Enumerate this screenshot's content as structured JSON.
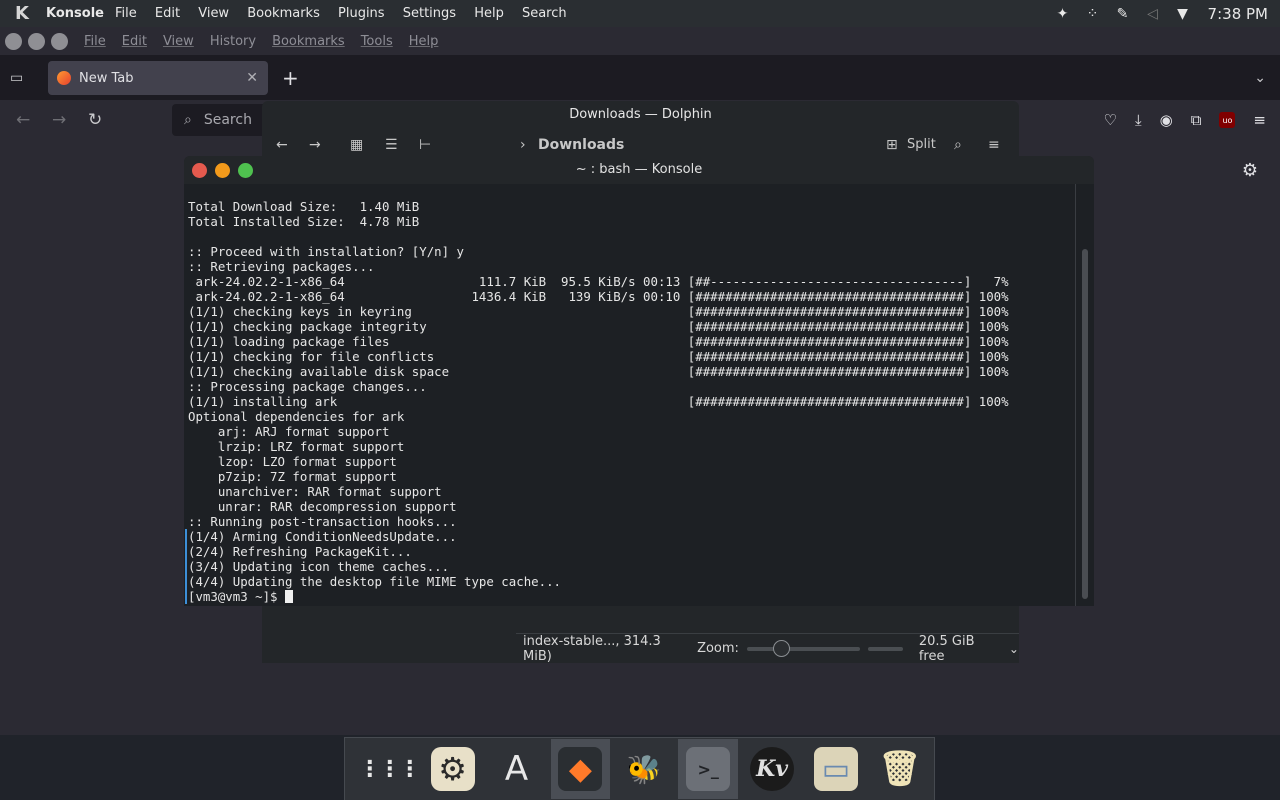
{
  "topbar": {
    "app_name": "Konsole",
    "menu": [
      "File",
      "Edit",
      "View",
      "Bookmarks",
      "Plugins",
      "Settings",
      "Help",
      "Search"
    ],
    "clock": "7:38 PM",
    "tray_icons": [
      "bee-icon",
      "network-icon",
      "pen-icon",
      "volume-icon",
      "chevron-down-icon"
    ]
  },
  "browser": {
    "menu": [
      "File",
      "Edit",
      "View",
      "History",
      "Bookmarks",
      "Tools",
      "Help"
    ],
    "tab_title": "New Tab",
    "search_placeholder": "Search"
  },
  "dolphin": {
    "title": "Downloads — Dolphin",
    "breadcrumb": "Downloads",
    "split_label": "Split",
    "status_file": "index-stable..., 314.3 MiB)",
    "zoom_label": "Zoom:",
    "zoom_level": 0.22,
    "free_space": "20.5 GiB free"
  },
  "konsole": {
    "title": "~ : bash — Konsole",
    "lines": [
      "Total Download Size:   1.40 MiB",
      "Total Installed Size:  4.78 MiB",
      "",
      ":: Proceed with installation? [Y/n] y",
      ":: Retrieving packages...",
      " ark-24.02.2-1-x86_64                  111.7 KiB  95.5 KiB/s 00:13 [##----------------------------------]   7%",
      " ark-24.02.2-1-x86_64                 1436.4 KiB   139 KiB/s 00:10 [####################################] 100%",
      "(1/1) checking keys in keyring                                     [####################################] 100%",
      "(1/1) checking package integrity                                   [####################################] 100%",
      "(1/1) loading package files                                        [####################################] 100%",
      "(1/1) checking for file conflicts                                  [####################################] 100%",
      "(1/1) checking available disk space                                [####################################] 100%",
      ":: Processing package changes...",
      "(1/1) installing ark                                               [####################################] 100%",
      "Optional dependencies for ark",
      "    arj: ARJ format support",
      "    lrzip: LRZ format support",
      "    lzop: LZO format support",
      "    p7zip: 7Z format support",
      "    unarchiver: RAR format support",
      "    unrar: RAR decompression support",
      ":: Running post-transaction hooks...",
      "(1/4) Arming ConditionNeedsUpdate...",
      "(2/4) Refreshing PackageKit...",
      "(3/4) Updating icon theme caches...",
      "(4/4) Updating the desktop file MIME type cache..."
    ],
    "prompt": "[vm3@vm3 ~]$ "
  },
  "dock": {
    "items": [
      {
        "name": "app-grid",
        "icon": "app-grid-icon",
        "glyph": "⋮⋮⋮"
      },
      {
        "name": "system-settings",
        "icon": "settings-gear-icon",
        "glyph": "⚙"
      },
      {
        "name": "font-viewer",
        "icon": "font-a-icon",
        "glyph": "A"
      },
      {
        "name": "firefox",
        "icon": "firefox-fox-icon",
        "glyph": "◆"
      },
      {
        "name": "bee-app",
        "icon": "bee-icon",
        "glyph": "🐝"
      },
      {
        "name": "konsole",
        "icon": "terminal-icon",
        "glyph": ">_"
      },
      {
        "name": "kvantum",
        "icon": "kv-icon",
        "glyph": "Kv"
      },
      {
        "name": "files",
        "icon": "folder-icon",
        "glyph": "▭"
      },
      {
        "name": "trash",
        "icon": "trash-icon",
        "glyph": "🗑"
      }
    ]
  }
}
